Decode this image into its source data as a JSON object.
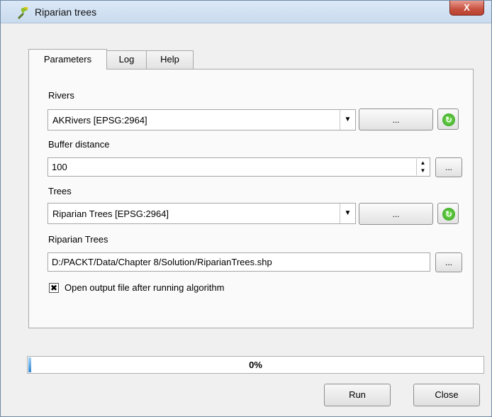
{
  "window": {
    "title": "Riparian trees",
    "close_label": "X"
  },
  "tabs": [
    {
      "label": "Parameters",
      "active": true
    },
    {
      "label": "Log",
      "active": false
    },
    {
      "label": "Help",
      "active": false
    }
  ],
  "params": {
    "rivers": {
      "label": "Rivers",
      "value": "AKRivers [EPSG:2964]",
      "browse": "..."
    },
    "buffer": {
      "label": "Buffer distance",
      "value": "100",
      "browse": "..."
    },
    "trees": {
      "label": "Trees",
      "value": "Riparian Trees [EPSG:2964]",
      "browse": "..."
    },
    "output": {
      "label": "Riparian Trees",
      "value": "D:/PACKT/Data/Chapter 8/Solution/RiparianTrees.shp",
      "browse": "..."
    },
    "open_output": {
      "label": "Open output file after running algorithm",
      "checked": true,
      "mark": "✖"
    }
  },
  "progress": {
    "value": 0,
    "text": "0%"
  },
  "buttons": {
    "run": "Run",
    "close": "Close"
  },
  "icons": {
    "app": "qgis-processing-icon",
    "refresh": "refresh-icon"
  }
}
